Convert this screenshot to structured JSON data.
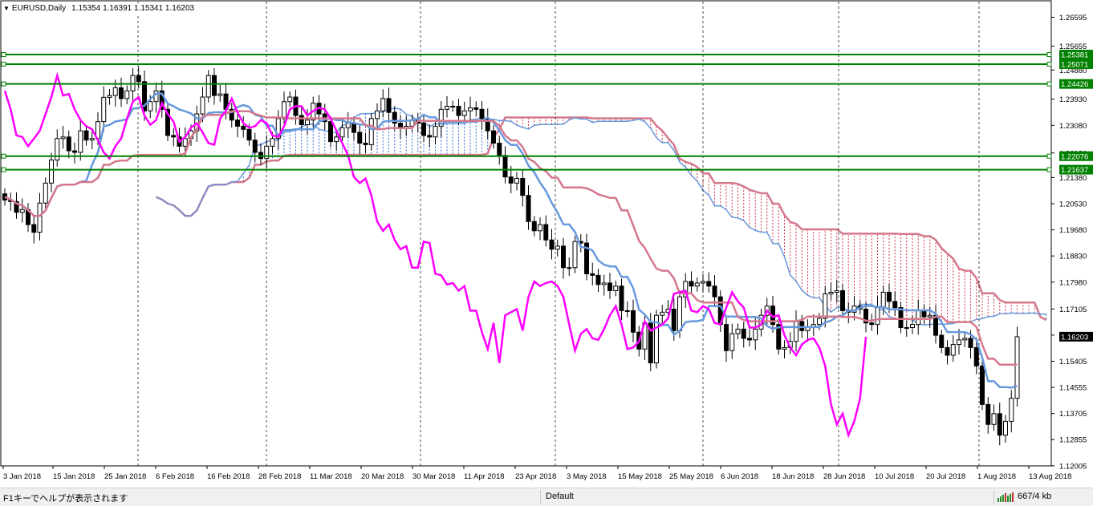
{
  "header": {
    "symbol": "EURUSD,Daily",
    "ohlc": "1.15354 1.16391 1.15341 1.16203"
  },
  "colors": {
    "bull_candle": "#ffffff",
    "bear_candle": "#000000",
    "tenkan": "#6699dd",
    "kijun": "#d4788c",
    "chikou": "#ff00ff",
    "cloud_bull": "#3366cc",
    "cloud_bear": "#cc3344",
    "hline": "#008000",
    "grid": "#000000",
    "price_bg": "#000000"
  },
  "chart_data": {
    "type": "candlestick",
    "symbol": "EURUSD",
    "timeframe": "Daily",
    "ylim": [
      1.12,
      1.27
    ],
    "price_ticks": [
      "1.26595",
      "1.25655",
      "1.24880",
      "1.23930",
      "1.23080",
      "1.22180",
      "1.21380",
      "1.20530",
      "1.19680",
      "1.18830",
      "1.17980",
      "1.17105",
      "1.16255",
      "1.15405",
      "1.14555",
      "1.13705",
      "1.12855",
      "1.12005"
    ],
    "date_ticks": [
      "3 Jan 2018",
      "15 Jan 2018",
      "25 Jan 2018",
      "6 Feb 2018",
      "16 Feb 2018",
      "28 Feb 2018",
      "11 Mar 2018",
      "20 Mar 2018",
      "30 Mar 2018",
      "11 Apr 2018",
      "23 Apr 2018",
      "3 May 2018",
      "15 May 2018",
      "25 May 2018",
      "6 Jun 2018",
      "18 Jun 2018",
      "28 Jun 2018",
      "10 Jul 2018",
      "20 Jul 2018",
      "1 Aug 2018",
      "13 Aug 2018"
    ],
    "horizontal_lines": [
      "1.25381",
      "1.25071",
      "1.24426",
      "1.22076",
      "1.21637"
    ],
    "current_price": "1.16203",
    "closes": [
      1.2065,
      1.206,
      1.2025,
      1.2034,
      1.1985,
      1.196,
      1.2055,
      1.212,
      1.2195,
      1.2265,
      1.227,
      1.2225,
      1.222,
      1.229,
      1.226,
      1.2265,
      1.232,
      1.2399,
      1.2405,
      1.243,
      1.2395,
      1.242,
      1.247,
      1.245,
      1.2355,
      1.2385,
      1.242,
      1.236,
      1.2275,
      1.227,
      1.224,
      1.2265,
      1.229,
      1.2345,
      1.24,
      1.247,
      1.2405,
      1.241,
      1.236,
      1.2325,
      1.2305,
      1.2295,
      1.226,
      1.222,
      1.22,
      1.224,
      1.2265,
      1.233,
      1.2385,
      1.24,
      1.234,
      1.231,
      1.2325,
      1.238,
      1.2345,
      1.232,
      1.2255,
      1.227,
      1.23,
      1.2315,
      1.2285,
      1.225,
      1.2245,
      1.233,
      1.2355,
      1.2395,
      1.235,
      1.2315,
      1.23,
      1.2305,
      1.2325,
      1.2315,
      1.2275,
      1.227,
      1.2305,
      1.236,
      1.237,
      1.237,
      1.234,
      1.2355,
      1.2365,
      1.236,
      1.233,
      1.229,
      1.225,
      1.221,
      1.214,
      1.212,
      1.2135,
      1.208,
      1.1995,
      1.1965,
      1.1985,
      1.1935,
      1.1905,
      1.1915,
      1.1845,
      1.1845,
      1.193,
      1.1925,
      1.1825,
      1.182,
      1.179,
      1.1795,
      1.177,
      1.1785,
      1.1705,
      1.1705,
      1.1635,
      1.158,
      1.1665,
      1.1535,
      1.169,
      1.17,
      1.171,
      1.164,
      1.175,
      1.18,
      1.1785,
      1.1795,
      1.18,
      1.1785,
      1.175,
      1.166,
      1.1575,
      1.163,
      1.1645,
      1.1615,
      1.161,
      1.1645,
      1.169,
      1.172,
      1.166,
      1.158,
      1.1585,
      1.1605,
      1.167,
      1.164,
      1.165,
      1.166,
      1.168,
      1.176,
      1.1765,
      1.177,
      1.1705,
      1.17,
      1.172,
      1.171,
      1.1665,
      1.166,
      1.1715,
      1.1765,
      1.1735,
      1.1715,
      1.165,
      1.165,
      1.166,
      1.1705,
      1.1685,
      1.169,
      1.1625,
      1.1585,
      1.156,
      1.1595,
      1.161,
      1.1615,
      1.1585,
      1.1525,
      1.14,
      1.1335,
      1.137,
      1.13,
      1.1345,
      1.142,
      1.162
    ]
  },
  "statusbar": {
    "help": "F1キーでヘルプが表示されます",
    "profile": "Default",
    "traffic": "667/4 kb"
  }
}
